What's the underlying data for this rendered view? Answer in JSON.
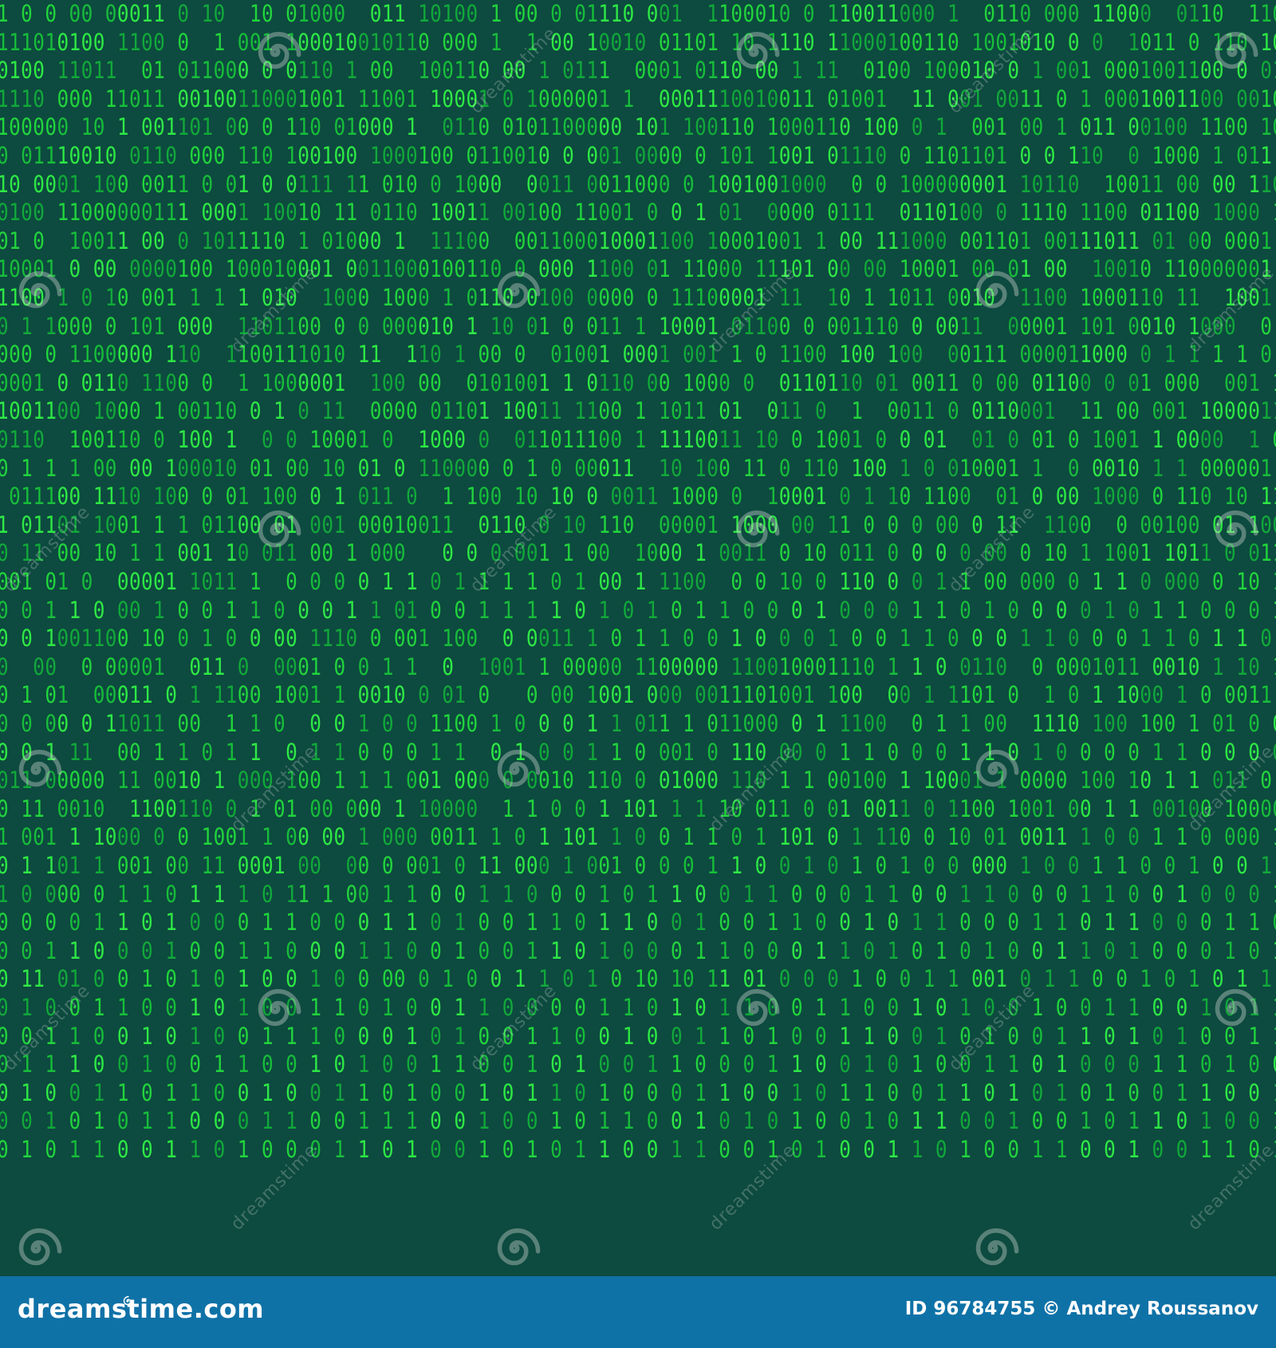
{
  "background": {
    "color": "#0d4a3f",
    "digit_colors": [
      "#21d43c",
      "#11a83a",
      "#2ee845",
      "#17bd3a"
    ]
  },
  "binary_rows": [
    "1 0 0 00 00011 0 10  10 01000  011 10100 1 00 0 01110 001  1100010 0 110011000 1  0110 000 11000  0110  110",
    "111010100 1100 0  1 001 100010010110 000 1  1 00 10010 01101 10 1110 11000100110 1001010 0 0  1011 0 110 10",
    "0100 11011  01 011000 0 0110 1 00  100110 00 1 0111  0001 0110 00 1 11  0100 100010 0 1 001 0001001100 0 01 1",
    "1110 000 11011 00100110001001 11001 10001 0 1000001 1  0001110010011 01001  11 001 0011 0 1 0001001100 00100",
    "100000 10 1 001101 00 0 110 01000 1  0110 0101100000 101 100110 1000110 100 0 1  001 00 1 011 00100 1100 100",
    "0 01110010 0110 000 110 100100 1000100 0110010 0 001 0000 0 101 1001 01110 0 1101101 0 0 110  0 1000 1 011 0",
    "10 0001 100 0011 0 01 0 0111 11 010 0 1000  0011 0011000 0 1001001000  0 0 100000001 10110  10011 00 00 1100 1",
    "0100 11000000111 0001 10010 11 0110 10011 00100 11001 0 0 1 01  0000 0111  0110100 0 1110 1100 01100 1000 11",
    "01 0  10011 00 0 1011110 1 01000 1  11100  001100010001100 10001001 1 00 111000 001101 00111011 01 00 0001 00",
    "10001 0 00 0000100 100010001 0011000100110 0 000 1100 01 11000 11101 00 00 10001 00 01 00  10010 110000001 1",
    "1100 1 0 10 001 1 1 1 010  1000 1000 1 0110 0100 0000 0 11100001 11  10 1 1011 0010  1100 1000110 11  1001 000",
    "0 1 1000 0 101 000  1101100 0 0 000010 1 10 01 0 011 1 10001 01100 0 001110 0 0011  00001 101 0010 1000  0 001",
    "000 0 1100000 110  1100111010 11  110 1 00 0  01001 0001 001 1 0 1100 100 100  00111 000011000 0 1 1 1 1 0 100",
    "0001 0 0110 1100 0  1 1000001  100 00  0101001 1 0110 00 1000 0  0110110 01 0011 0 00 01100 0 01 000  001 1011",
    "1001100 1000 1 00110 0 1 0 11  0000 01101 10011 1100 1 1011 01  011 0  1  0011 0 0110001  11 00 001 1000011100 0 11",
    "0110  100110 0 100 1  0 0 10001 0  1000 0  011011100 1 1110011 10 0 1001 0 0 01  01 0 01 0 1001 1 0000  1 00 0110 00",
    "0 1 1 1 00 00 100010 01 00 10 01 0 110000 0 1 0 00011  10 100 11 0 110 100 1 0 010001 1  0 0010 1 1 000001 0 1 001",
    " 011100 1110 100 0 01 100 0 1 011 0  1 100 10 10 0 0011 1000 0  10001 0 1 10 1100  01 0 00 1000 0 110 10 11 0 00 0 1",
    "1 01101 1001 1 1 01100 01 001 00010011  0110 0 10 110  00001 1000 00 11 0 0 0 00 0 11  1100  0 00100 01 100 10 01 1 0",
    "0 11 00 10 1 1 001 10 011 00 1 000   0 0 0 001 1 00  1000 1 0011 0 10 011 0 0 0 0 00 0 10 1 1001 1011 0 01100 1 0 0 1 0",
    "001 01 0  00001 1011 1  0 0 0 0 1 1 0 1 1 1 1 0 1 00 1 1100  0 0 10 0 110 0 0 1 1 00 000 0 1 1 0 000 0 10 10 01 1 0",
    "0 0 1 1 0 00 1 0 0 1 1 0 0 0 1 1 01 0 0 1 1 1 1 0 1 0 1 0 1 1 0 0 0 1 0 0 0 1 1 0 1 0 0 0 0 1 0 1 1 0 0 0 1 0 1 1 0 0 1 1 0",
    "0 0 1001100 10 0 1 0 0 00 1110 0 001 100  0 0011 1 0 1 1 0 0 1 0 0 0 1 0 0 1 1 0 0 0 1 1 0 0 0 1 1 0 1 1 0 0 0 0 1 0 0 1 1 0",
    "0  00  0 00001  011 0  0001 0 0 1 1  0  1001 1 00000 1100000 110010001110 1 1 0 0110  0 0001011 0010 1 10 1  00 11",
    "0 1 01  00011 0 1 1100 1001 1 0010 0 01 0   0 00 1001 000 0011101001 100  00 1 1101 0  1 0 1 1000 1 0 0011 1100  0 11 0 0",
    "0 0 00 0 11011 00  1 1 0  0 0 1 0 0 1100 1 0 0 0 1 1 011 1 011000 0 1 1100  0 1 1 00  1110 100 100 1 01 0 0 0 1100 1 1",
    "0 0 1 11  00 1 1 0 1 1  0 1 1 0 0 0 1 1  0 1 0 0 1 1 0 001 0 110 00 0 1 1 0 0 0 1 1 0 1 0 0 0 0 1 1 0 0 0 0 1 1 0 0 1 1 0 0",
    "011 00000 11 0010 1 000 100 1 1 1 001 000 0 0010 110 0 01000 110 1 1 00100 1 10001 1 0000 100 10 1 1 011 0 0000 00",
    "0 11 0010  1100110 0 1 01 00 000 1 10000  1 1 0 0 1 101 1 1 10 011 0 01 0011 0 1100 1001 00 1 1 00100 10000 1 11",
    "1 001 1 1000 0 0 1001 1 00 00 1 000 0011 1 0 1 101 1 0 0 1 1 0 1 101 0 1 110 0 10 01 0011 1 0 0 1 1 0 000 1011 1 100 10 0",
    "0 1 101 1 001 00 11 0001 00  00 0 001 0 11 000 1 001 0 0 0 1 1 0 0 1 0 1 0 1 0 0 000 1 0 0 1 1 0 0 1 0 0 1 0 0 0 1 1 00 0",
    "1 0 000 0 1 1 0 1 1 1 0 11 1 00 1 1 0 0 1 1 0 0 0 1 0 1 1 0 0 1 1 0 0 0 1 1 0 0 1 1 0 0 0 1 1 0 0 1 0 0 0 1 1 0 1 1 0 0 1 1 0",
    "0 0 0 0 1 1 0 1 0 0 0 1 1 0 0 0 1 1 0 1 0 0 1 1 0 1 1 0 0 1 0 0 1 1 0 0 1 0 1 1 0 0 0 1 1 0 1 1 0 0 0 1 1 0 1 0 0 1 1 0 0 1 0",
    "0 0 1 1 0 0 0 1 0 0 1 1 0 0 0 1 1 0 0 1 0 0 1 1 0 1 0 0 0 1 1 0 0 0 1 1 0 1 0 1 0 1 0 0 1 1 0 1 0 0 0 1 0 1 1 0 0 1 0 1 1 0 0",
    "0 11 01 0 0 1 0 1 0 1 0 0 1 0 0 00 0 1 0 0 1 1 0 1 0 10 10 11 01 0 0 0 1 0 0 1 1 001 0 1 1 0 0 1 0 1 0 1 1 1 0 0 11 0 1 0 0 1",
    "0 1 0 0 1 1 0 0 1 0 1 0 0 1 1 0 1 0 0 1 1 0 0 0 0 1 1 0 1 0 1 1 0 0 1 1 0 0 1 0 1 0 0 1 0 0 1 1 0 0 1 0 1 1 0 0 0 1 1 0 0 1",
    "0 0 1 1 0 0 1 0 1 0 0 1 1 1 0 0 0 1 0 1 0 0 1 1 0 0 1 0 0 1 1 0 1 0 0 1 1 0 0 1 0 1 0 0 1 1 0 1 0 1 0 0 1 1 0 0 1 0 1 1 0 0 1",
    "0 1 1 1 0 0 1 0 0 1 1 0 0 1 0 1 0 0 1 1 0 0 1 0 1 0 0 1 1 0 0 0 1 1 0 0 1 0 1 0 0 1 1 0 1 0 0 0 1 1 0 1 0 0 1 1 0 0 1 0 1 0",
    "0 1 0 0 1 1 0 1 1 0 0 1 0 0 1 1 0 1 0 0 1 0 1 1 0 1 0 0 0 1 1 0 0 1 0 1 1 0 0 1 1 0 1 0 1 0 1 0 0 1 1 0 0 1 0 1 1 0 0 1 0 1",
    "0 0 1 0 1 0 1 1 0 0 0 1 1 0 0 1 1 1 0 0 1 0 0 1 0 1 1 0 0 1 0 1 0 1 0 0 1 0 1 1 0 0 1 0 0 1 0 1 1 0 1 0 0 1 0 1 1 0 0 1 1 0",
    "0 1 0 1 1 0 0 1 1 0 1 0 0 0 1 1 0 1 0 0 1 0 1 0 1 1 0 0 1 1 0 0 1 0 1 0 0 1 1 0 1 0 0 1 1 0 0 1 0 0 1 1 0 1 0 0 1 1 0 0 1 0"
  ],
  "watermark": {
    "site_text": "dreamstime",
    "spiral_icon": "dreamstime-spiral-icon"
  },
  "footer": {
    "brand": "dreamstime.com",
    "image_id_label": "ID 96784755",
    "copyright_symbol": "©",
    "author": "Andrey Roussanov",
    "background_color": "#0f72a7"
  }
}
